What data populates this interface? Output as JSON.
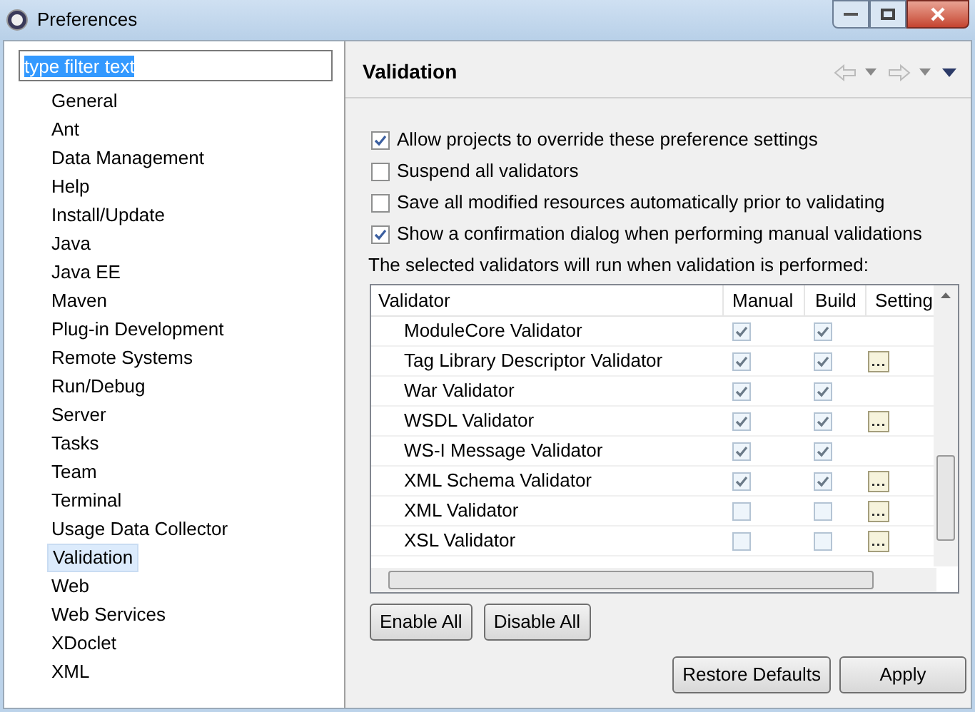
{
  "window": {
    "title": "Preferences"
  },
  "filter": {
    "value": "type filter text"
  },
  "sidebar": {
    "items": [
      {
        "label": "General",
        "selected": false
      },
      {
        "label": "Ant",
        "selected": false
      },
      {
        "label": "Data Management",
        "selected": false
      },
      {
        "label": "Help",
        "selected": false
      },
      {
        "label": "Install/Update",
        "selected": false
      },
      {
        "label": "Java",
        "selected": false
      },
      {
        "label": "Java EE",
        "selected": false
      },
      {
        "label": "Maven",
        "selected": false
      },
      {
        "label": "Plug-in Development",
        "selected": false
      },
      {
        "label": "Remote Systems",
        "selected": false
      },
      {
        "label": "Run/Debug",
        "selected": false
      },
      {
        "label": "Server",
        "selected": false
      },
      {
        "label": "Tasks",
        "selected": false
      },
      {
        "label": "Team",
        "selected": false
      },
      {
        "label": "Terminal",
        "selected": false
      },
      {
        "label": "Usage Data Collector",
        "selected": false
      },
      {
        "label": "Validation",
        "selected": true
      },
      {
        "label": "Web",
        "selected": false
      },
      {
        "label": "Web Services",
        "selected": false
      },
      {
        "label": "XDoclet",
        "selected": false
      },
      {
        "label": "XML",
        "selected": false
      }
    ]
  },
  "page": {
    "title": "Validation",
    "options": [
      {
        "label": "Allow projects to override these preference settings",
        "checked": true
      },
      {
        "label": "Suspend all validators",
        "checked": false
      },
      {
        "label": "Save all modified resources automatically prior to validating",
        "checked": false
      },
      {
        "label": "Show a confirmation dialog when performing manual validations",
        "checked": true
      }
    ],
    "note": "The selected validators will run when validation is performed:",
    "table": {
      "columns": [
        "Validator",
        "Manual",
        "Build",
        "Setting"
      ],
      "rows": [
        {
          "name": "ModuleCore Validator",
          "manual": true,
          "build": true,
          "settings": false
        },
        {
          "name": "Tag Library Descriptor Validator",
          "manual": true,
          "build": true,
          "settings": true
        },
        {
          "name": "War Validator",
          "manual": true,
          "build": true,
          "settings": false
        },
        {
          "name": "WSDL Validator",
          "manual": true,
          "build": true,
          "settings": true
        },
        {
          "name": "WS-I Message Validator",
          "manual": true,
          "build": true,
          "settings": false
        },
        {
          "name": "XML Schema Validator",
          "manual": true,
          "build": true,
          "settings": true
        },
        {
          "name": "XML Validator",
          "manual": false,
          "build": false,
          "settings": true
        },
        {
          "name": "XSL Validator",
          "manual": false,
          "build": false,
          "settings": true
        }
      ]
    },
    "table_buttons": [
      "Enable All",
      "Disable All"
    ]
  },
  "buttons": [
    "Restore Defaults",
    "Apply"
  ]
}
